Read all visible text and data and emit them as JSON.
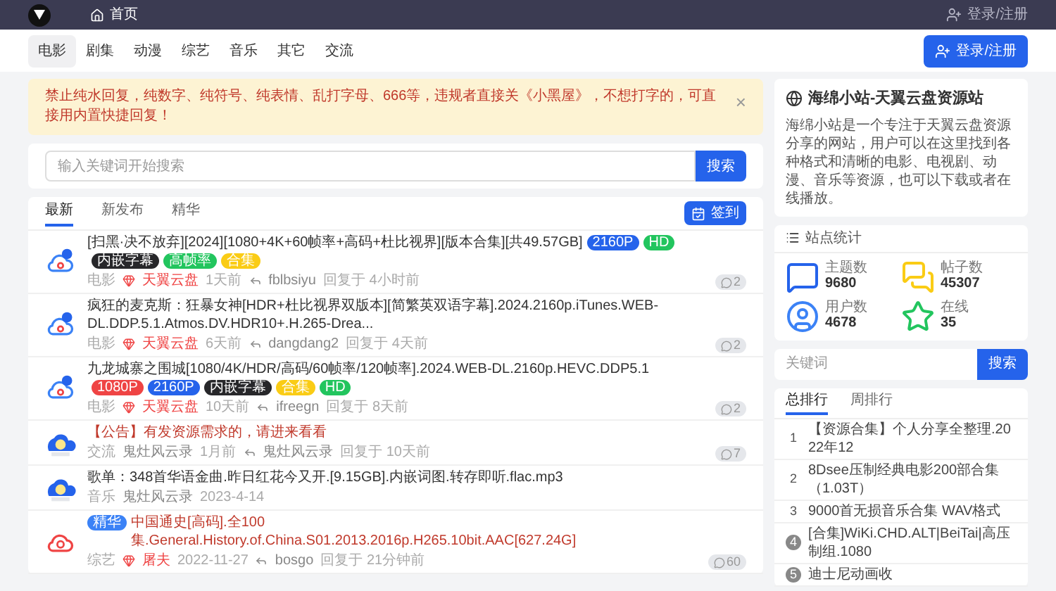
{
  "topbar": {
    "home": "首页",
    "login": "登录/注册"
  },
  "nav": {
    "items": [
      {
        "label": "电影",
        "selected": true
      },
      {
        "label": "剧集",
        "selected": false
      },
      {
        "label": "动漫",
        "selected": false
      },
      {
        "label": "综艺",
        "selected": false
      },
      {
        "label": "音乐",
        "selected": false
      },
      {
        "label": "其它",
        "selected": false
      },
      {
        "label": "交流",
        "selected": false
      }
    ],
    "button": "登录/注册"
  },
  "alert": {
    "text": "禁止纯水回复，纯数字、纯符号、纯表情、乱打字母、666等，违规者直接关《小黑屋》，不想打字的，可直接用内置快捷回复！",
    "close": "×"
  },
  "search": {
    "placeholder": "输入关键词开始搜索",
    "button": "搜索"
  },
  "list": {
    "tabs": [
      {
        "label": "最新",
        "selected": true
      },
      {
        "label": "新发布",
        "selected": false
      },
      {
        "label": "精华",
        "selected": false
      }
    ],
    "checkin": "签到",
    "rows": [
      {
        "kind": "cloud",
        "title": "[扫黑·决不放弃][2024][1080+4K+60帧率+高码+杜比视界][版本合集][共49.57GB]",
        "red": false,
        "tags": [
          {
            "text": "2160P",
            "color": "#2563eb"
          },
          {
            "text": "HD",
            "color": "#22c55e"
          },
          {
            "text": "内嵌字幕",
            "color": "#27272a"
          },
          {
            "text": "高帧率",
            "color": "#22c55e"
          },
          {
            "text": "合集",
            "color": "#facc15"
          }
        ],
        "category": "电影",
        "source": "天翼云盘",
        "source_red": true,
        "time": "1天前",
        "replier": "fblbsiyu",
        "reply_time": "回复于 4小时前",
        "comments": "2"
      },
      {
        "kind": "cloud",
        "title": "疯狂的麦克斯：狂暴女神[HDR+杜比视界双版本][简繁英双语字幕].2024.2160p.iTunes.WEB-DL.DDP.5.1.Atmos.DV.HDR10+.H.265-Drea...",
        "red": false,
        "tags": [],
        "category": "电影",
        "source": "天翼云盘",
        "source_red": true,
        "time": "6天前",
        "replier": "dangdang2",
        "reply_time": "回复于 4天前",
        "comments": "2"
      },
      {
        "kind": "cloud",
        "title": "九龙城寨之围城[1080/4K/HDR/高码/60帧率/120帧率].2024.WEB-DL.2160p.HEVC.DDP5.1",
        "red": false,
        "tags": [
          {
            "text": "1080P",
            "color": "#ef4444"
          },
          {
            "text": "2160P",
            "color": "#2563eb"
          },
          {
            "text": "内嵌字幕",
            "color": "#27272a"
          },
          {
            "text": "合集",
            "color": "#facc15"
          },
          {
            "text": "HD",
            "color": "#22c55e"
          }
        ],
        "category": "电影",
        "source": "天翼云盘",
        "source_red": true,
        "time": "10天前",
        "replier": "ifreegn",
        "reply_time": "回复于 8天前",
        "comments": "2"
      },
      {
        "kind": "mascot",
        "title": "【公告】有发资源需求的，请进来看看",
        "red": true,
        "tags": [],
        "category": "交流",
        "source": "鬼灶风云录",
        "source_red": false,
        "time": "1月前",
        "replier": "鬼灶风云录",
        "reply_time": "回复于 10天前",
        "comments": "7"
      },
      {
        "kind": "mascot",
        "title": "歌单：348首华语金曲.昨日红花今又开.[9.15GB].内嵌词图.转存即听.flac.mp3",
        "red": false,
        "tags": [],
        "category": "音乐",
        "source": "鬼灶风云录",
        "source_red": false,
        "time": "2023-4-14"
      },
      {
        "kind": "swirl",
        "badge": "精华",
        "title": "中国通史[高码].全100集.General.History.of.China.S01.2013.2016p.H265.10bit.AAC[627.24G]",
        "red": true,
        "tags": [],
        "category": "综艺",
        "source": "屠夫",
        "source_red": true,
        "time": "2022-11-27",
        "replier": "bosgo",
        "reply_time": "回复于 21分钟前",
        "comments": "60"
      }
    ]
  },
  "site": {
    "title": "海绵小站-天翼云盘资源站",
    "intro": "海绵小站是一个专注于天翼云盘资源分享的网站，用户可以在这里找到各种格式和清晰的电影、电视剧、动漫、音乐等资源，也可以下载或者在线播放。"
  },
  "stats": {
    "title": "站点统计",
    "items": [
      {
        "kind": "topics",
        "label": "主题数",
        "value": "9680"
      },
      {
        "kind": "posts",
        "label": "帖子数",
        "value": "45307"
      },
      {
        "kind": "users",
        "label": "用户数",
        "value": "4678"
      },
      {
        "kind": "online",
        "label": "在线",
        "value": "35"
      }
    ]
  },
  "side_search": {
    "placeholder": "关键词",
    "button": "搜索"
  },
  "ranking": {
    "tabs": [
      {
        "label": "总排行",
        "selected": true
      },
      {
        "label": "周排行",
        "selected": false
      }
    ],
    "items": [
      {
        "rank": "1",
        "title": "【资源合集】个人分享全整理.2022年12"
      },
      {
        "rank": "2",
        "title": "8Dsee压制经典电影200部合集（1.03T）"
      },
      {
        "rank": "3",
        "title": "9000首无损音乐合集 WAV格式"
      },
      {
        "rank": "4",
        "title": "[合集]WiKi.CHD.ALT|BeiTai|高压制组.1080"
      },
      {
        "rank": "5",
        "title": "迪士尼动画收"
      }
    ]
  }
}
